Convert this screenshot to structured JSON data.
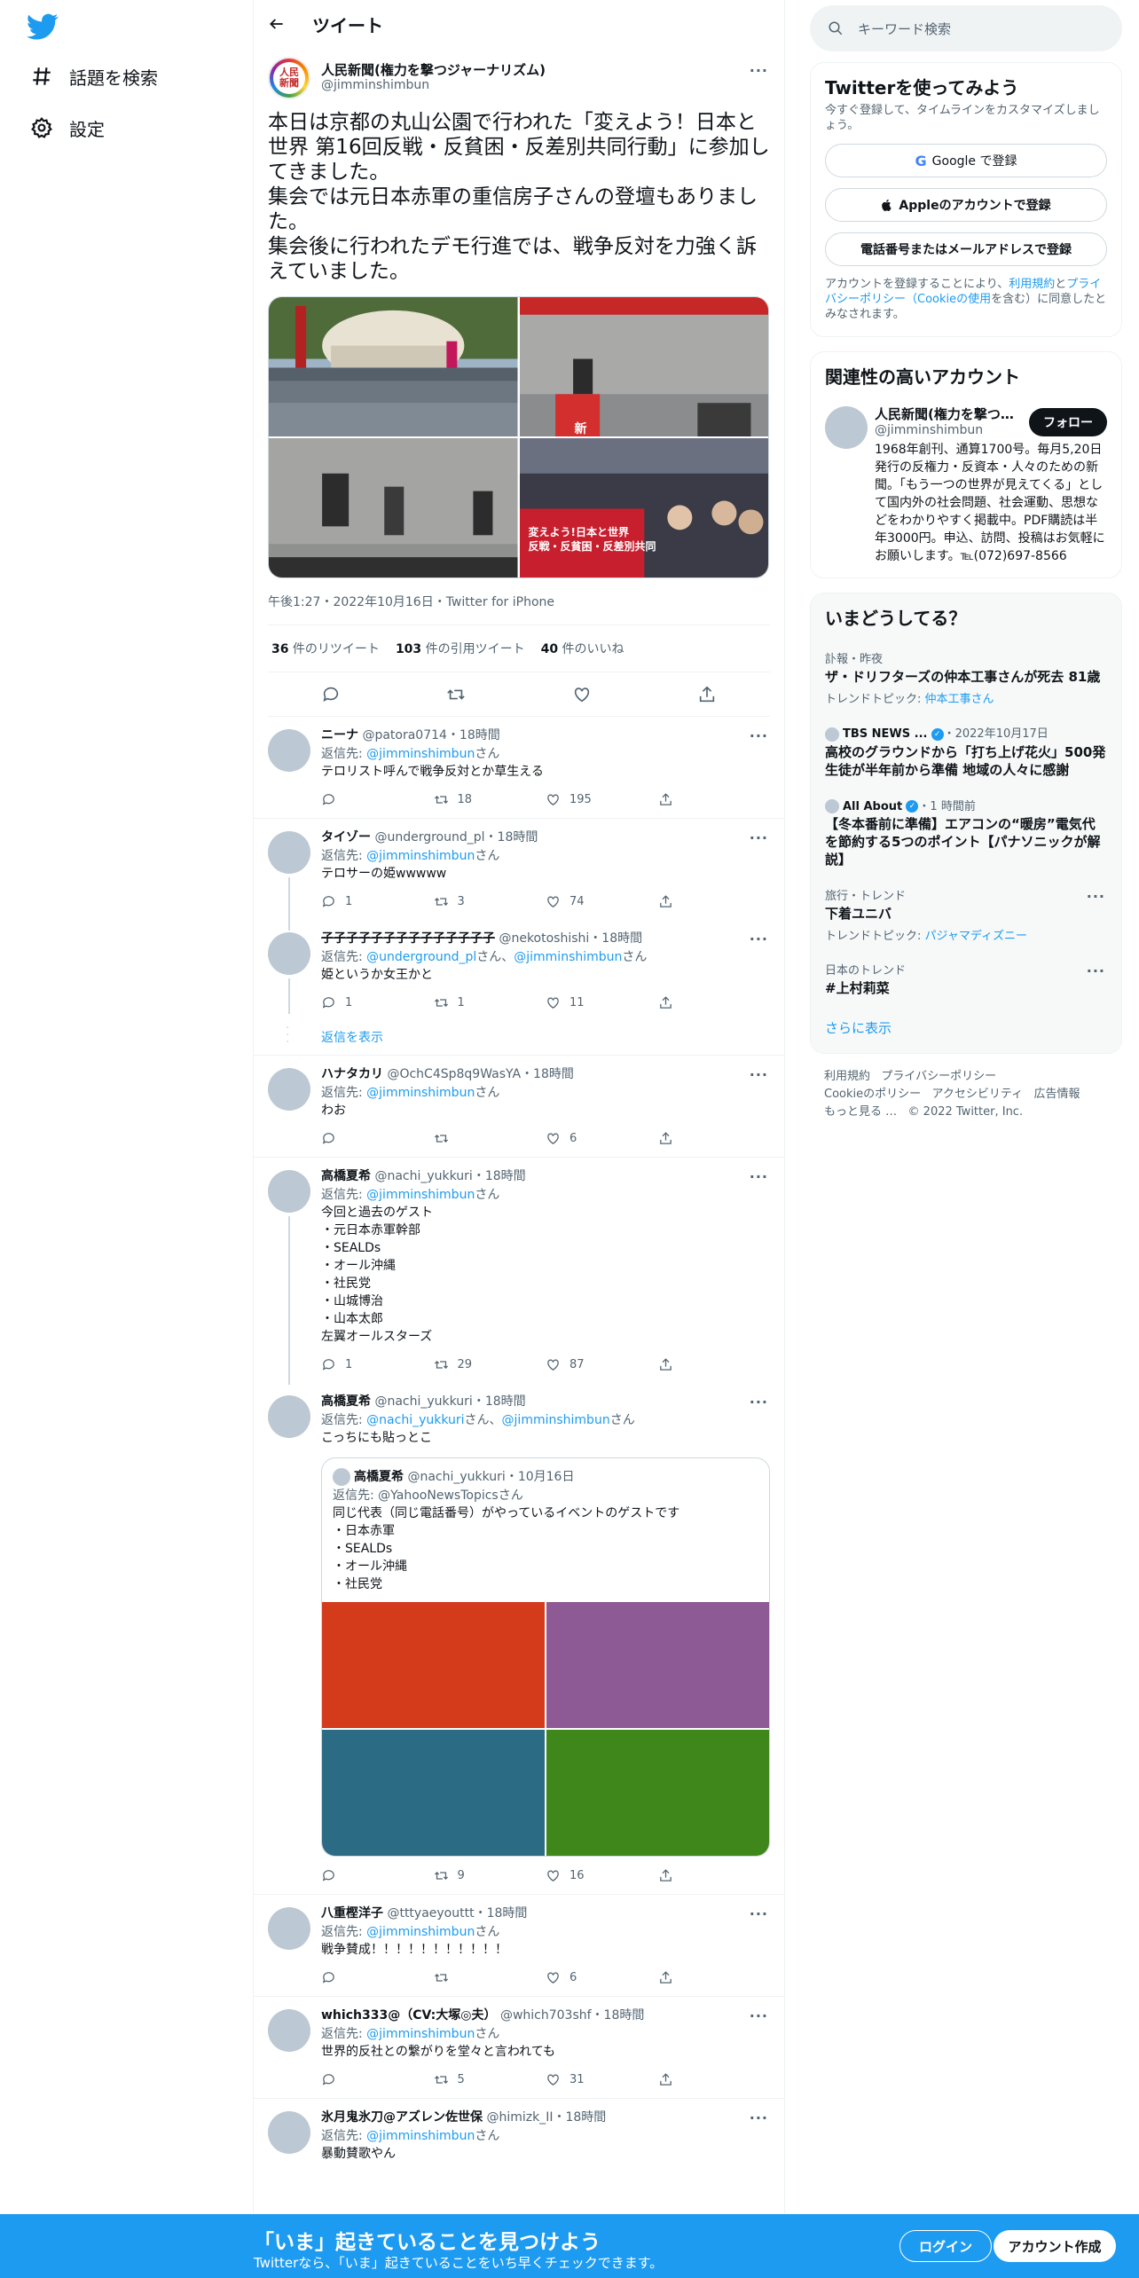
{
  "nav": {
    "explore": "話題を検索",
    "settings": "設定"
  },
  "header": {
    "title": "ツイート"
  },
  "tweet": {
    "name": "人民新聞(権力を撃つジャーナリズム)",
    "handle": "@jimminshimbun",
    "avatar_text": "人民\n新聞",
    "text": "本日は京都の丸山公園で行われた「変えよう！日本と世界 第16回反戦・反貧困・反差別共同行動」に参加してきました。\n集会では元日本赤軍の重信房子さんの登壇もありました。\n集会後に行われたデモ行進では、戦争反対を力強く訴えていました。",
    "photo_sign": "新",
    "photo_banner": "変えよう!日本と世界\n反戦・反貧困・反差別共同",
    "meta": "午後1:27・2022年10月16日・Twitter for iPhone",
    "retweets": "36",
    "retweets_label": " 件のリツイート",
    "quotes": "103",
    "quotes_label": " 件の引用ツイート",
    "likes": "40",
    "likes_label": " 件のいいね"
  },
  "replies": [
    {
      "name": "ニーナ",
      "handle": "@patora0714",
      "time": "・18時間",
      "to_label": "返信先: ",
      "to": "@jimminshimbun",
      "to_suffix": "さん",
      "text": "テロリスト呼んで戦争反対とか草生える",
      "reply": "",
      "rt": "18",
      "like": "195"
    },
    {
      "name": "タイゾー",
      "handle": "@underground_pl",
      "time": "・18時間",
      "to_label": "返信先: ",
      "to": "@jimminshimbun",
      "to_suffix": "さん",
      "text": "テロサーの姫wwwww",
      "reply": "1",
      "rt": "3",
      "like": "74"
    },
    {
      "name": "子子子子子子子子子子子子子子",
      "handle": "@nekotoshishi",
      "time": "・18時間",
      "to_label": "返信先: ",
      "to": "@underground_pl",
      "to_mid": "さん、",
      "to2": "@jimminshimbun",
      "to_suffix": "さん",
      "text": "姫というか女王かと",
      "reply": "1",
      "rt": "1",
      "like": "11"
    },
    {
      "name": "ハナタカリ",
      "handle": "@OchC4Sp8q9WasYA",
      "time": "・18時間",
      "to_label": "返信先: ",
      "to": "@jimminshimbun",
      "to_suffix": "さん",
      "text": "わお",
      "reply": "",
      "rt": "",
      "like": "6"
    },
    {
      "name": "高橋夏希",
      "handle": "@nachi_yukkuri",
      "time": "・18時間",
      "to_label": "返信先: ",
      "to": "@jimminshimbun",
      "to_suffix": "さん",
      "text": "今回と過去のゲスト\n・元日本赤軍幹部\n・SEALDs\n・オール沖縄\n・社民党\n・山城博治\n・山本太郎\n左翼オールスターズ",
      "reply": "1",
      "rt": "29",
      "like": "87"
    },
    {
      "name": "高橋夏希",
      "handle": "@nachi_yukkuri",
      "time": "・18時間",
      "to_label": "返信先: ",
      "to": "@nachi_yukkuri",
      "to_mid": "さん、",
      "to2": "@jimminshimbun",
      "to_suffix": "さん",
      "text": "こっちにも貼っとこ",
      "reply": "",
      "rt": "9",
      "like": "16"
    },
    {
      "name": "八重樫洋子",
      "handle": "@tttyaeyouttt",
      "time": "・18時間",
      "to_label": "返信先: ",
      "to": "@jimminshimbun",
      "to_suffix": "さん",
      "text": "戦争賛成！！！！！！！！！！！",
      "reply": "",
      "rt": "",
      "like": "6"
    },
    {
      "name": "which333@（CV:大塚◎夫）",
      "handle": "@which703shf",
      "time": "・18時間",
      "to_label": "返信先: ",
      "to": "@jimminshimbun",
      "to_suffix": "さん",
      "text": "世界的反社との繋がりを堂々と言われても",
      "reply": "",
      "rt": "5",
      "like": "31"
    },
    {
      "name": "氷月鬼氷刀@アズレン佐世保",
      "handle": "@himizk_II",
      "time": "・18時間",
      "to_label": "返信先: ",
      "to": "@jimminshimbun",
      "to_suffix": "さん",
      "text": "暴動賛歌やん"
    }
  ],
  "show_replies": "返信を表示",
  "quote": {
    "name": "高橋夏希",
    "handle": "@nachi_yukkuri",
    "time": "・10月16日",
    "to": "返信先: @YahooNewsTopicsさん",
    "text": "同じ代表（同じ電話番号）がやっているイベントのゲストです\n・日本赤軍\n・SEALDs\n・オール沖縄\n・社民党",
    "colors": [
      "#d33b1b",
      "#8e5a96",
      "#2b6b84",
      "#40871b"
    ]
  },
  "search": {
    "placeholder": "キーワード検索"
  },
  "signup": {
    "title": "Twitterを使ってみよう",
    "subtitle": "今すぐ登録して、タイムラインをカスタマイズしましょう。",
    "google": "Google で登録",
    "apple": "Appleのアカウントで登録",
    "phone": "電話番号またはメールアドレスで登録",
    "terms_pre": "アカウントを登録することにより、",
    "terms_link": "利用規約",
    "terms_mid": "と",
    "privacy_link": "プライバシーポリシー（Cookieの使用",
    "terms_post": "を含む）に同意したとみなされます。"
  },
  "related": {
    "title": "関連性の高いアカウント",
    "name": "人民新聞(権力を撃つ…",
    "handle": "@jimminshimbun",
    "follow": "フォロー",
    "bio": "1968年創刊、通算1700号。毎月5,20日発行の反権力・反資本・人々のための新聞。「もう一つの世界が見えてくる」として国内外の社会問題、社会運動、思想などをわかりやすく掲載中。PDF購読は半年3000円。申込、訪問、投稿はお気軽にお願いします。℡(072)697-8566"
  },
  "trends": {
    "title": "いまどうしてる？",
    "items": [
      {
        "cat": "訃報・昨夜",
        "title": "ザ・ドリフターズの仲本工事さんが死去 81歳",
        "topic_label": "トレンドトピック: ",
        "topic": "仲本工事さん"
      },
      {
        "source": "TBS NEWS ...",
        "time": "・2022年10月17日",
        "title": "高校のグラウンドから「打ち上げ花火」500発 生徒が半年前から準備 地域の人々に感謝"
      },
      {
        "source": "All About",
        "time": "・1 時間前",
        "title": "【冬本番前に準備】エアコンの“暖房”電気代を節約する5つのポイント【パナソニックが解説】"
      },
      {
        "cat": "旅行・トレンド",
        "title": "下着ユニバ",
        "topic_label": "トレンドトピック: ",
        "topic": "パジャマディズニー"
      },
      {
        "cat": "日本のトレンド",
        "title": "#上村莉菜"
      }
    ],
    "more": "さらに表示"
  },
  "footer": {
    "l1": [
      "利用規約",
      "プライバシーポリシー"
    ],
    "l2": [
      "Cookieのポリシー",
      "アクセシビリティ",
      "広告情報"
    ],
    "more": "もっと見る …",
    "copy": "© 2022 Twitter, Inc."
  },
  "banner": {
    "title": "「いま」起きていることを見つけよう",
    "subtitle": "Twitterなら、「いま」起きていることをいち早くチェックできます。",
    "login": "ログイン",
    "signup": "アカウント作成"
  }
}
